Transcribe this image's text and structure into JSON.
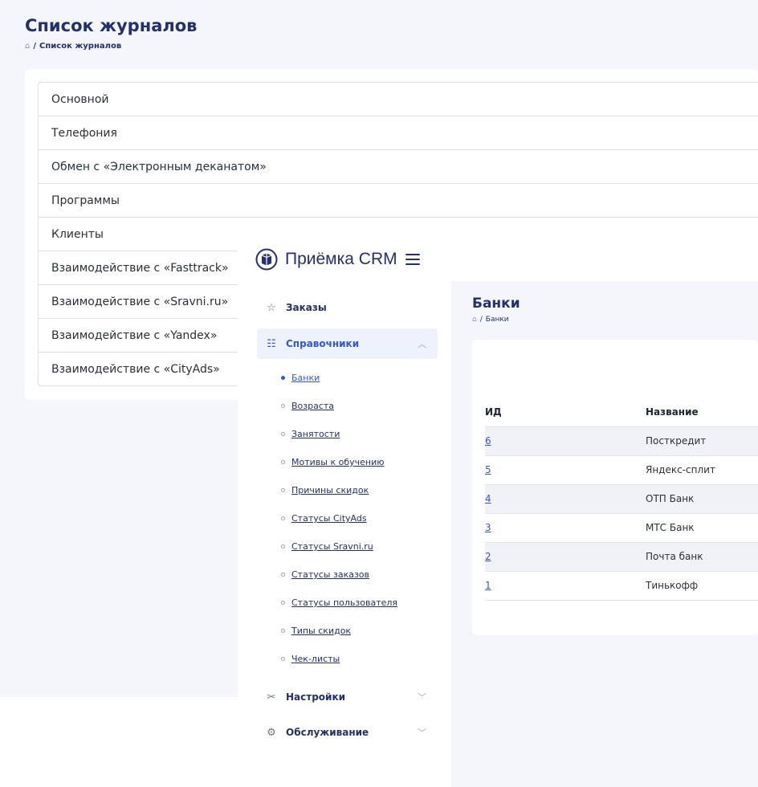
{
  "background": {
    "title": "Список журналов",
    "breadcrumb": "Список журналов",
    "journals": [
      "Основной",
      "Телефония",
      "Обмен с «Электронным деканатом»",
      "Программы",
      "Клиенты",
      "Взаимодействие с «Fasttrack»",
      "Взаимодействие с «Sravni.ru»",
      "Взаимодействие с «Yandex»",
      "Взаимодействие с «CityAds»"
    ]
  },
  "crm": {
    "app_title": "Приёмка CRM",
    "nav": {
      "orders": "Заказы",
      "references": "Справочники",
      "settings": "Настройки",
      "maintenance": "Обслуживание"
    },
    "sub_items": [
      "Банки",
      "Возраста",
      "Занятости",
      "Мотивы к обучению",
      "Причины скидок",
      "Статусы CityAds",
      "Статусы Sravni.ru",
      "Статусы заказов",
      "Статусы пользователя",
      "Типы скидок",
      "Чек-листы"
    ],
    "page_title": "Банки",
    "breadcrumb": "Банки",
    "table": {
      "columns": [
        "ИД",
        "Название"
      ],
      "rows": [
        {
          "id": "6",
          "name": "Посткредит"
        },
        {
          "id": "5",
          "name": "Яндекс-сплит"
        },
        {
          "id": "4",
          "name": "ОТП Банк"
        },
        {
          "id": "3",
          "name": "МТС Банк"
        },
        {
          "id": "2",
          "name": "Почта банк"
        },
        {
          "id": "1",
          "name": "Тинькофф"
        }
      ]
    }
  },
  "colors": {
    "brand": "#23306b",
    "accent": "#3557d6",
    "background": "#f4f6fb"
  },
  "icons": {
    "home": "home-icon",
    "orders": "star-icon",
    "references": "list-icon",
    "settings": "tools-icon",
    "maintenance": "gear-icon",
    "logo": "database-icon"
  }
}
